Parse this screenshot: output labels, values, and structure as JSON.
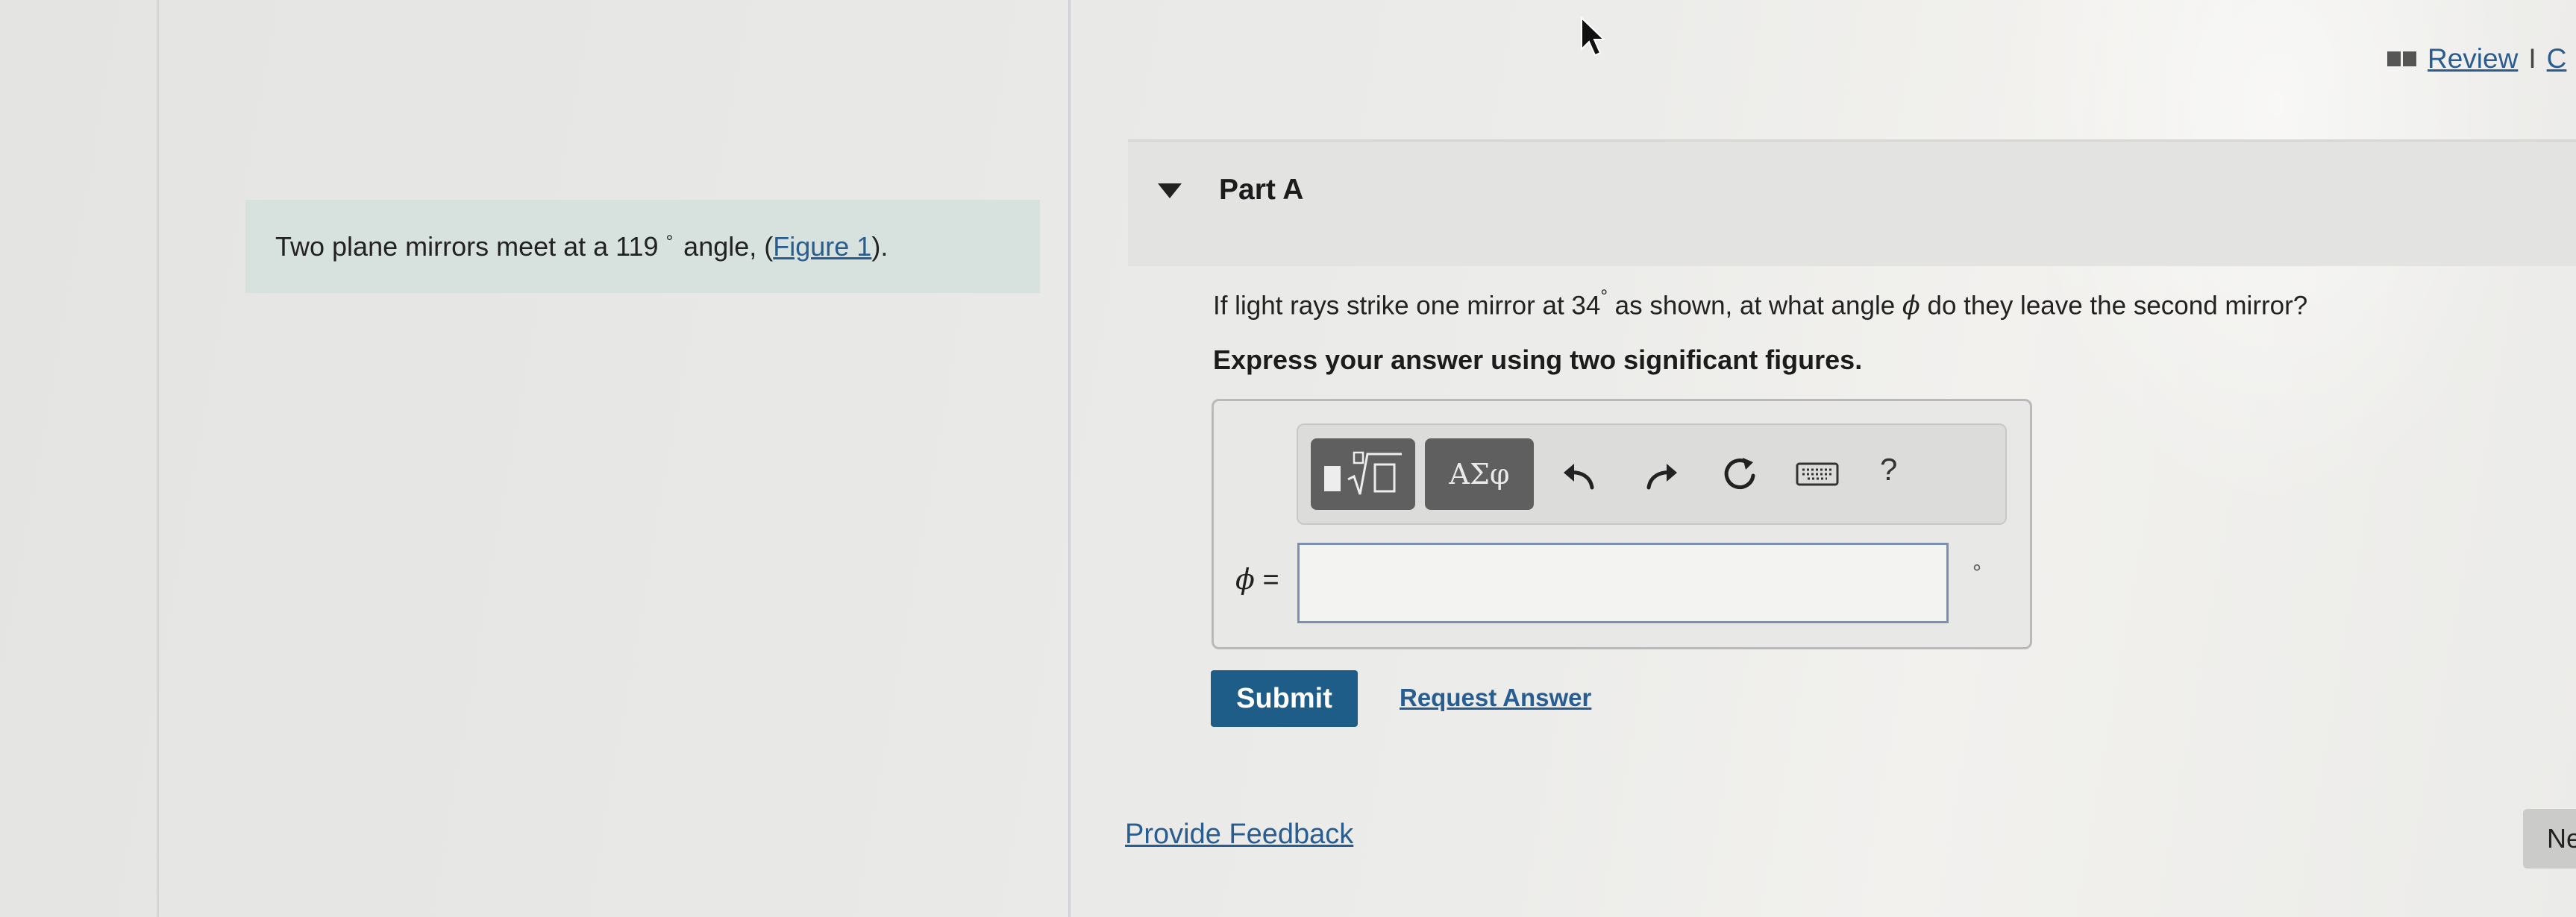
{
  "header": {
    "review_label": "Review",
    "separator": "I",
    "next_link_cut": "C"
  },
  "intro": {
    "text_before": "Two plane mirrors meet at a 119",
    "degree_symbol": "°",
    "text_after": "angle, (",
    "figure_link": "Figure 1",
    "text_end": ")."
  },
  "part": {
    "title": "Part A",
    "question_before": "If light rays strike one mirror at 34",
    "question_degree": "°",
    "question_middle": " as shown, at what angle ",
    "question_symbol": "ϕ",
    "question_after": " do they leave the second mirror?",
    "instruction": "Express your answer using two significant figures."
  },
  "toolbar": {
    "symbols_label": "ΑΣφ",
    "help_label": "?"
  },
  "answer": {
    "variable": "ϕ",
    "equals": " =",
    "value": "",
    "unit": "°"
  },
  "actions": {
    "submit_label": "Submit",
    "request_answer_label": "Request Answer",
    "feedback_label": "Provide Feedback",
    "next_label": "Ne"
  },
  "colors": {
    "link": "#2a5d8f",
    "submit_bg": "#1e5d88",
    "intro_bg": "#d7e2df",
    "toolbar_button": "#5f5f5f"
  },
  "icons": [
    "book-icon",
    "disclosure-triangle-icon",
    "templates-icon",
    "undo-icon",
    "redo-icon",
    "reset-icon",
    "keyboard-icon",
    "help-icon",
    "mouse-cursor-icon"
  ]
}
